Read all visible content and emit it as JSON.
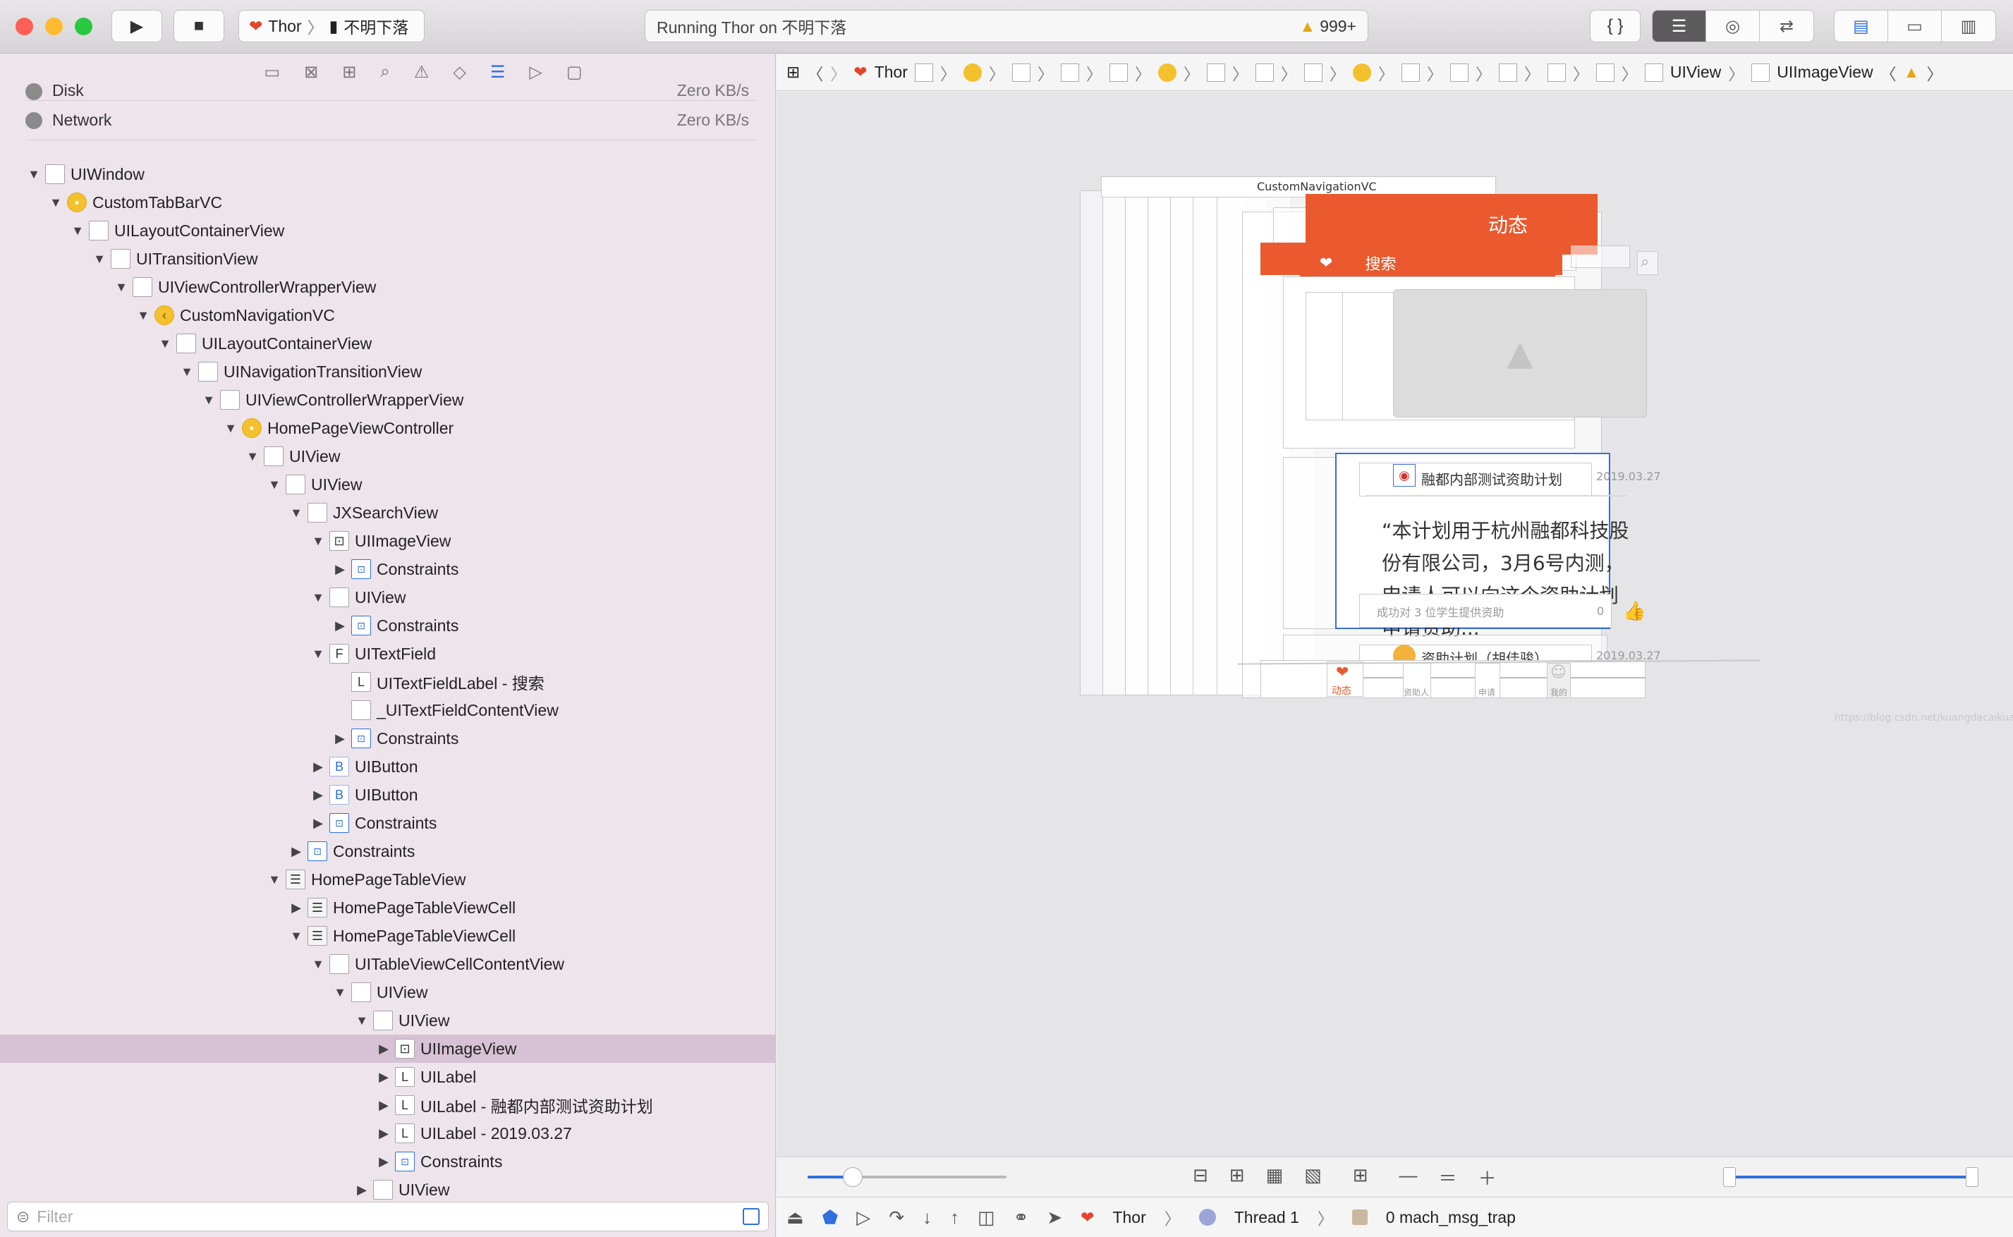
{
  "toolbar": {
    "scheme_target": "Thor",
    "device": "不明下落",
    "activity_text": "Running Thor on 不明下落",
    "warning_count": "999+",
    "colors": {
      "close": "#fe5f57",
      "minimize": "#febc2e",
      "zoom": "#28c840"
    }
  },
  "navigator": {
    "gauges": [
      {
        "label": "Disk",
        "value": "Zero KB/s"
      },
      {
        "label": "Network",
        "value": "Zero KB/s"
      }
    ],
    "tree": [
      {
        "label": "UIWindow",
        "depth": 0,
        "expanded": true,
        "icon": "view"
      },
      {
        "label": "CustomTabBarVC",
        "depth": 1,
        "expanded": true,
        "icon": "vc"
      },
      {
        "label": "UILayoutContainerView",
        "depth": 2,
        "expanded": true,
        "icon": "view"
      },
      {
        "label": "UITransitionView",
        "depth": 3,
        "expanded": true,
        "icon": "view"
      },
      {
        "label": "UIViewControllerWrapperView",
        "depth": 4,
        "expanded": true,
        "icon": "view"
      },
      {
        "label": "CustomNavigationVC",
        "depth": 5,
        "expanded": true,
        "icon": "nav"
      },
      {
        "label": "UILayoutContainerView",
        "depth": 6,
        "expanded": true,
        "icon": "view"
      },
      {
        "label": "UINavigationTransitionView",
        "depth": 7,
        "expanded": true,
        "icon": "view"
      },
      {
        "label": "UIViewControllerWrapperView",
        "depth": 8,
        "expanded": true,
        "icon": "view"
      },
      {
        "label": "HomePageViewController",
        "depth": 9,
        "expanded": true,
        "icon": "vc"
      },
      {
        "label": "UIView",
        "depth": 10,
        "expanded": true,
        "icon": "view"
      },
      {
        "label": "UIView",
        "depth": 11,
        "expanded": true,
        "icon": "view"
      },
      {
        "label": "JXSearchView",
        "depth": 12,
        "expanded": true,
        "icon": "view"
      },
      {
        "label": "UIImageView",
        "depth": 13,
        "expanded": true,
        "icon": "img"
      },
      {
        "label": "Constraints",
        "depth": 14,
        "expanded": false,
        "icon": "con"
      },
      {
        "label": "UIView",
        "depth": 13,
        "expanded": true,
        "icon": "view"
      },
      {
        "label": "Constraints",
        "depth": 14,
        "expanded": false,
        "icon": "con"
      },
      {
        "label": "UITextField",
        "depth": 13,
        "expanded": true,
        "icon": "field"
      },
      {
        "label": "UITextFieldLabel - 搜索",
        "depth": 14,
        "expanded": null,
        "icon": "label"
      },
      {
        "label": "_UITextFieldContentView",
        "depth": 14,
        "expanded": null,
        "icon": "view"
      },
      {
        "label": "Constraints",
        "depth": 14,
        "expanded": false,
        "icon": "con"
      },
      {
        "label": "UIButton",
        "depth": 13,
        "expanded": false,
        "icon": "btn"
      },
      {
        "label": "UIButton",
        "depth": 13,
        "expanded": false,
        "icon": "btn"
      },
      {
        "label": "Constraints",
        "depth": 13,
        "expanded": false,
        "icon": "con"
      },
      {
        "label": "Constraints",
        "depth": 12,
        "expanded": false,
        "icon": "con"
      },
      {
        "label": "HomePageTableView",
        "depth": 11,
        "expanded": true,
        "icon": "tbl"
      },
      {
        "label": "HomePageTableViewCell",
        "depth": 12,
        "expanded": false,
        "icon": "tbl"
      },
      {
        "label": "HomePageTableViewCell",
        "depth": 12,
        "expanded": true,
        "icon": "tbl"
      },
      {
        "label": "UITableViewCellContentView",
        "depth": 13,
        "expanded": true,
        "icon": "view"
      },
      {
        "label": "UIView",
        "depth": 14,
        "expanded": true,
        "icon": "view"
      },
      {
        "label": "UIView",
        "depth": 15,
        "expanded": true,
        "icon": "view"
      },
      {
        "label": "UIImageView",
        "depth": 16,
        "expanded": false,
        "icon": "img",
        "selected": true
      },
      {
        "label": "UILabel",
        "depth": 16,
        "expanded": false,
        "icon": "label"
      },
      {
        "label": "UILabel - 融都内部测试资助计划",
        "depth": 16,
        "expanded": false,
        "icon": "label"
      },
      {
        "label": "UILabel - 2019.03.27",
        "depth": 16,
        "expanded": false,
        "icon": "label"
      },
      {
        "label": "Constraints",
        "depth": 16,
        "expanded": false,
        "icon": "con"
      },
      {
        "label": "UIView",
        "depth": 15,
        "expanded": false,
        "icon": "view"
      }
    ],
    "filter_placeholder": "Filter"
  },
  "jumpbar": {
    "project": "Thor",
    "path_tail_1": "UIView",
    "path_tail_2": "UIImageView"
  },
  "canvas": {
    "nav_title": "CustomNavigationVC",
    "tab_title": "动态",
    "search_placeholder": "搜索",
    "card1_title": "融都内部测试资助计划",
    "card1_date": "2019.03.27",
    "card1_body": "“本计划用于杭州融都科技股份有限公司，3月6号内测，申请人可以向这个资助计划申请资助...",
    "card1_footer": "成功对 3 位学生提供资助",
    "card1_count": "0",
    "card2_title": "资助计划（胡佳骏）",
    "card2_date": "2019.03.27",
    "tabbar": [
      "动态",
      "资助人",
      "申请",
      "我的"
    ],
    "watermark": "https://blog.csdn.net/kuangdacaikuang",
    "accent": "#ea5a2e"
  },
  "debugbar": {
    "process": "Thor",
    "thread": "Thread 1",
    "frame": "0 mach_msg_trap"
  }
}
